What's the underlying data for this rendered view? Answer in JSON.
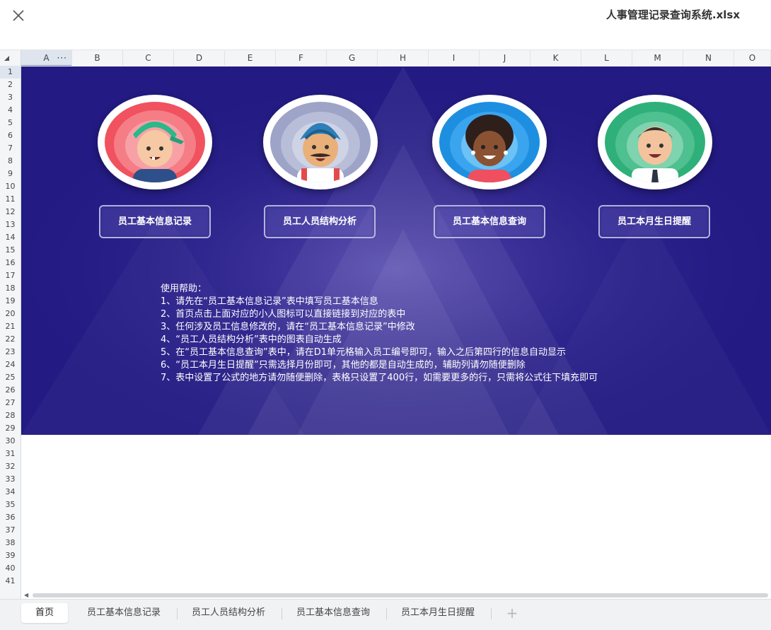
{
  "window": {
    "title": "人事管理记录查询系统.xlsx",
    "close_icon": "close-icon"
  },
  "columns": [
    "A",
    "B",
    "C",
    "D",
    "E",
    "F",
    "G",
    "H",
    "I",
    "J",
    "K",
    "L",
    "M",
    "N",
    "O"
  ],
  "selected_column": "A",
  "rows": [
    "1",
    "2",
    "3",
    "4",
    "5",
    "6",
    "7",
    "8",
    "9",
    "10",
    "11",
    "12",
    "13",
    "14",
    "15",
    "16",
    "17",
    "18",
    "19",
    "20",
    "21",
    "22",
    "23",
    "24",
    "25",
    "26",
    "27",
    "28",
    "29",
    "30",
    "31",
    "32",
    "33",
    "34",
    "35",
    "36",
    "37",
    "38",
    "39",
    "40",
    "41"
  ],
  "selected_row": "1",
  "colors": {
    "banner": "#231a83",
    "active_tab": "#ffffff",
    "selection": "#2f8f5a"
  },
  "nav": {
    "buttons": [
      {
        "label": "员工基本信息记录",
        "avatar": "boy-with-cap-avatar"
      },
      {
        "label": "员工人员结构分析",
        "avatar": "man-with-turban-avatar"
      },
      {
        "label": "员工基本信息查询",
        "avatar": "woman-avatar"
      },
      {
        "label": "员工本月生日提醒",
        "avatar": "man-with-tie-avatar"
      }
    ]
  },
  "help": {
    "title": "使用帮助：",
    "lines": [
      "1、请先在“员工基本信息记录”表中填写员工基本信息",
      "2、首页点击上面对应的小人图标可以直接链接到对应的表中",
      "3、任何涉及员工信息修改的，请在“员工基本信息记录”中修改",
      "4、“员工人员结构分析”表中的图表自动生成",
      "5、在“员工基本信息查询”表中，请在D1单元格输入员工编号即可，输入之后第四行的信息自动显示",
      "6、“员工本月生日提醒”只需选择月份即可，其他的都是自动生成的，辅助列请勿随便删除",
      "7、表中设置了公式的地方请勿随便删除，表格只设置了400行，如需要更多的行，只需将公式往下填充即可"
    ]
  },
  "sheets": {
    "tabs": [
      "首页",
      "员工基本信息记录",
      "员工人员结构分析",
      "员工基本信息查询",
      "员工本月生日提醒"
    ],
    "active": "首页",
    "add_icon": "plus-icon"
  }
}
